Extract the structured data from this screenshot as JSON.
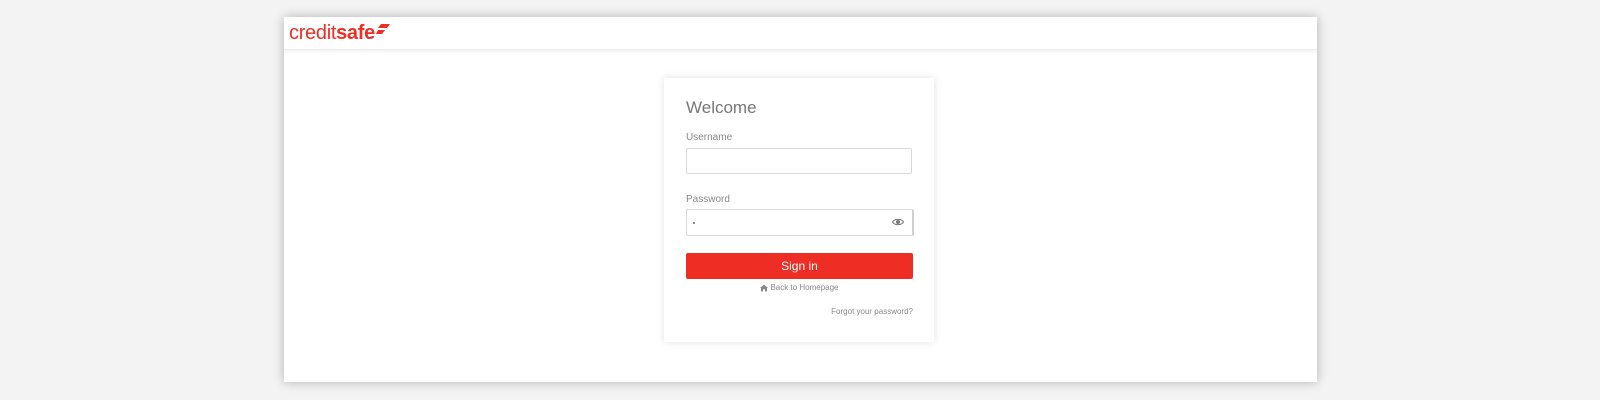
{
  "brand": {
    "logo_light": "credit",
    "logo_bold": "safe",
    "color": "#ee2d24"
  },
  "login": {
    "title": "Welcome",
    "username_label": "Username",
    "username_value": "",
    "password_label": "Password",
    "password_icon": "eye-icon",
    "signin_label": "Sign in",
    "back_icon": "home-icon",
    "back_label": "Back to Homepage",
    "forgot_label": "Forgot your password?"
  }
}
